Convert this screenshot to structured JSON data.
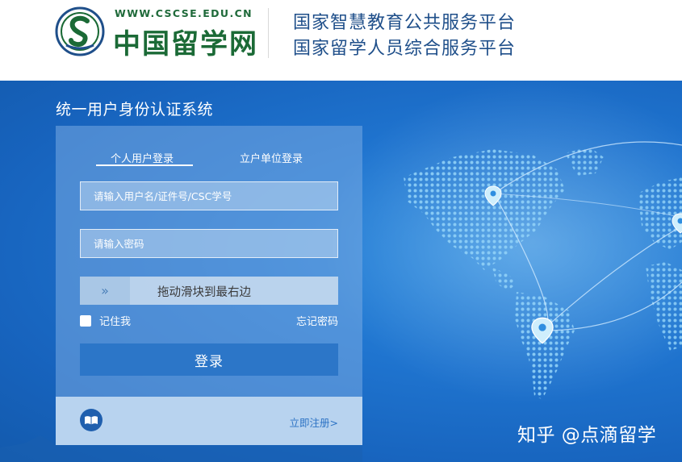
{
  "header": {
    "logo_url": "WWW.CSCSE.EDU.CN",
    "logo_name": "中国留学网",
    "line1": "国家智慧教育公共服务平台",
    "line2": "国家留学人员综合服务平台"
  },
  "system_title": "统一用户身份认证系统",
  "tabs": [
    {
      "label": "个人用户登录",
      "active": true
    },
    {
      "label": "立户单位登录",
      "active": false
    }
  ],
  "fields": {
    "username_placeholder": "请输入用户名/证件号/CSC学号",
    "password_placeholder": "请输入密码"
  },
  "slider": {
    "handle_glyph": "»",
    "text": "拖动滑块到最右边"
  },
  "remember_label": "记住我",
  "forgot_label": "忘记密码",
  "login_label": "登录",
  "register_label": "立即注册>",
  "watermark": "知乎 @点滴留学",
  "colors": {
    "header_text": "#1f4f8a",
    "logo_green": "#1b6a36",
    "background_blue": "#1f74cf",
    "login_button": "#2c76c8",
    "footer_panel": "#b8d3ef"
  },
  "icons": [
    "cscse-logo-icon",
    "map-pin-icon",
    "double-chevron-right-icon",
    "book-icon"
  ]
}
